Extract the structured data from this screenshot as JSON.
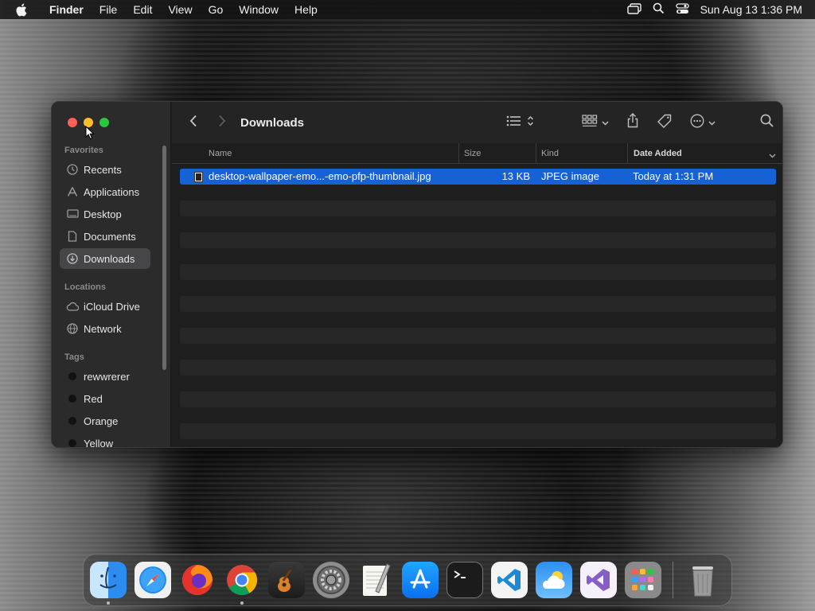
{
  "menubar": {
    "apple_icon": "apple-logo-icon",
    "items": [
      "Finder",
      "File",
      "Edit",
      "View",
      "Go",
      "Window",
      "Help"
    ],
    "clock": "Sun Aug 13  1:36 PM"
  },
  "window": {
    "title": "Downloads",
    "sidebar": {
      "favorites_heading": "Favorites",
      "favorites": [
        {
          "label": "Recents",
          "icon": "clock-icon"
        },
        {
          "label": "Applications",
          "icon": "applications-icon"
        },
        {
          "label": "Desktop",
          "icon": "desktop-icon"
        },
        {
          "label": "Documents",
          "icon": "document-icon"
        },
        {
          "label": "Downloads",
          "icon": "download-icon",
          "selected": true
        }
      ],
      "locations_heading": "Locations",
      "locations": [
        {
          "label": "iCloud Drive",
          "icon": "cloud-icon"
        },
        {
          "label": "Network",
          "icon": "globe-icon"
        }
      ],
      "tags_heading": "Tags",
      "tags": [
        {
          "label": "rewwrerer"
        },
        {
          "label": "Red"
        },
        {
          "label": "Orange"
        },
        {
          "label": "Yellow"
        }
      ]
    },
    "columns": {
      "name": "Name",
      "size": "Size",
      "kind": "Kind",
      "date": "Date Added"
    },
    "files": [
      {
        "name": "desktop-wallpaper-emo...-emo-pfp-thumbnail.jpg",
        "size": "13 KB",
        "kind": "JPEG image",
        "date": "Today at 1:31 PM",
        "selected": true
      }
    ]
  },
  "colors": {
    "selection": "#1662d4",
    "close": "#fe5f57",
    "minimize": "#febc2e",
    "zoom": "#28c840"
  },
  "dock": {
    "apps": [
      {
        "name": "Finder",
        "icon": "finder-icon",
        "running": true
      },
      {
        "name": "Safari",
        "icon": "safari-icon"
      },
      {
        "name": "Firefox",
        "icon": "firefox-icon"
      },
      {
        "name": "Google Chrome",
        "icon": "chrome-icon",
        "running": true
      },
      {
        "name": "GarageBand",
        "icon": "guitar-icon"
      },
      {
        "name": "System Settings",
        "icon": "gear-icon"
      },
      {
        "name": "TextEdit",
        "icon": "notepad-icon"
      },
      {
        "name": "App Store",
        "icon": "app-store-icon"
      },
      {
        "name": "Terminal",
        "icon": "terminal-icon"
      },
      {
        "name": "Visual Studio Code",
        "icon": "vscode-icon"
      },
      {
        "name": "Weather",
        "icon": "weather-icon"
      },
      {
        "name": "Visual Studio",
        "icon": "visual-studio-icon"
      },
      {
        "name": "Launchpad",
        "icon": "launchpad-icon"
      },
      {
        "name": "Trash",
        "icon": "trash-icon"
      }
    ]
  }
}
